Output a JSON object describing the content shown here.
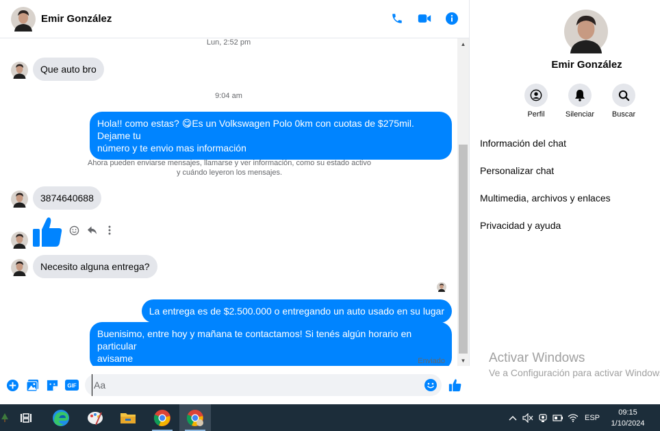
{
  "header": {
    "contact_name": "Emir González",
    "actions": {
      "call_icon": "phone-icon",
      "video_icon": "video-camera-icon",
      "info_icon": "info-icon"
    },
    "accent_color": "#0084ff"
  },
  "messages": {
    "timestamp_1": "Lun, 2:52 pm",
    "msg_1": "Que auto bro",
    "timestamp_2": "9:04 am",
    "msg_2_line1": "Hola!! como estas? 😋Es un Volkswagen Polo 0km con cuotas de $275mil. Dejame tu",
    "msg_2_line2": "número y te envio mas información",
    "system_line1": "Ahora pueden enviarse mensajes, llamarse y ver información, como su estado activo",
    "system_line2": "y cuándo leyeron los mensajes.",
    "msg_3": "3874640688",
    "msg_4": "Necesito alguna entrega?",
    "msg_5": "La entrega es de $2.500.000 o entregando un auto usado en su lugar",
    "msg_6_line1": "Buenisimo, entre hoy y mañana te contactamos! Si tenés algún horario en particular",
    "msg_6_line2": "avisame",
    "status": "Enviado"
  },
  "composer": {
    "placeholder": "Aa",
    "icons": [
      "plus-icon",
      "photo-icon",
      "sticker-icon",
      "gif-icon",
      "emoji-icon",
      "thumbs-up-icon"
    ],
    "gif_label": "GIF"
  },
  "side": {
    "name": "Emir González",
    "actions": [
      {
        "label": "Perfil",
        "icon": "profile-icon"
      },
      {
        "label": "Silenciar",
        "icon": "bell-icon"
      },
      {
        "label": "Buscar",
        "icon": "search-icon"
      }
    ],
    "menu": [
      "Información del chat",
      "Personalizar chat",
      "Multimedia, archivos y enlaces",
      "Privacidad y ayuda"
    ]
  },
  "watermark": {
    "line1": "Activar Windows",
    "line2": "Ve a Configuración para activar Windows."
  },
  "taskbar": {
    "language": "ESP",
    "time": "09:15",
    "date": "1/10/2024",
    "apps": [
      "task-view-icon",
      "edge-icon",
      "paint-icon",
      "file-explorer-icon",
      "chrome-icon",
      "chrome-profile-icon"
    ]
  }
}
